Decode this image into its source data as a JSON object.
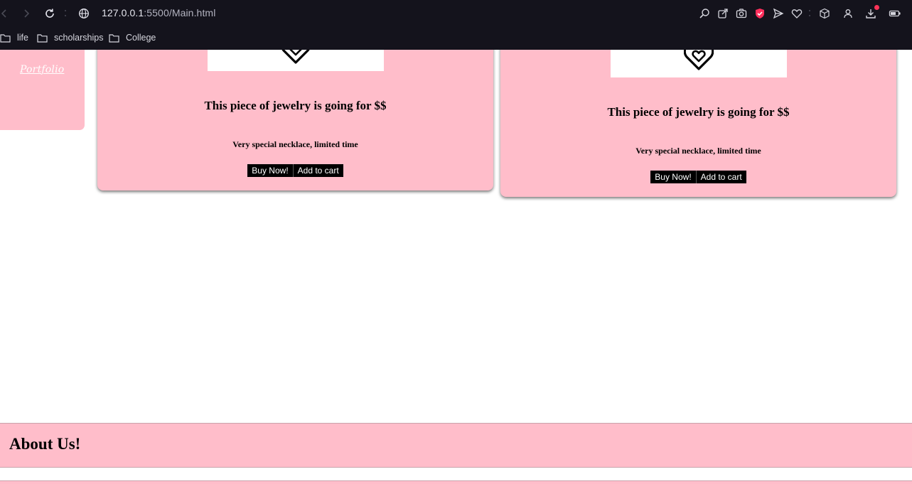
{
  "browser": {
    "url_host": "127.0.0.1",
    "url_path": ":5500/Main.html",
    "bookmarks": [
      {
        "label": "life"
      },
      {
        "label": "scholarships"
      },
      {
        "label": "College"
      }
    ],
    "icons": {
      "back": "arrow-left-icon",
      "forward": "arrow-right-icon",
      "reload": "reload-icon",
      "site": "globe-icon",
      "toolbar": [
        "search-icon",
        "share-icon",
        "camera-icon",
        "shield-icon",
        "send-icon",
        "heart-icon",
        "cube-icon",
        "profile-icon",
        "download-icon",
        "battery-icon"
      ]
    },
    "colors": {
      "chrome_bg": "#14131c",
      "notify_dot": "#ff3358",
      "shield": "#ff2f5c"
    }
  },
  "sidebar": {
    "logo_text": "Portfolio"
  },
  "products": [
    {
      "title": "This piece of jewelry is going for $$",
      "description": "Very special necklace, limited time",
      "buy_label": "Buy Now!",
      "cart_label": "Add to cart",
      "image_icon": "heart-pendant-icon"
    },
    {
      "title": "This piece of jewelry is going for $$",
      "description": "Very special necklace, limited time",
      "buy_label": "Buy Now!",
      "cart_label": "Add to cart",
      "image_icon": "heart-pendant-icon"
    }
  ],
  "about": {
    "heading": "About Us!"
  },
  "theme": {
    "accent_pink": "#ffbdca",
    "button_bg": "#000000",
    "button_text": "#ffffff"
  }
}
